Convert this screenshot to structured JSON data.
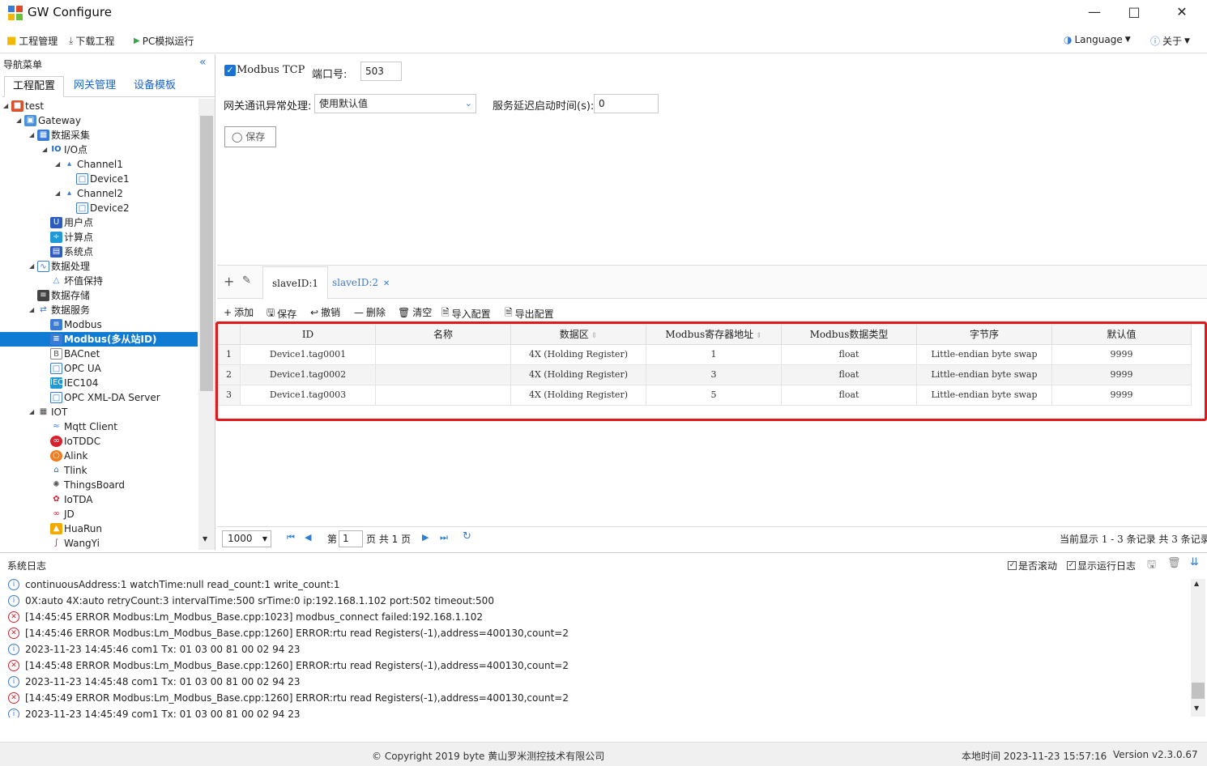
{
  "window": {
    "title": "GW Configure"
  },
  "toolbar": {
    "project_mgmt": "工程管理",
    "download_project": "下载工程",
    "pc_simulate": "PC模拟运行",
    "language": "Language",
    "about": "关于"
  },
  "nav": {
    "title": "导航菜单",
    "tabs": [
      "工程配置",
      "网关管理",
      "设备模板"
    ],
    "tree": {
      "test": "test",
      "gateway": "Gateway",
      "data_collect": "数据采集",
      "io_points": "I/O点",
      "channel1": "Channel1",
      "device1": "Device1",
      "channel2": "Channel2",
      "device2": "Device2",
      "user_points": "用户点",
      "calc_points": "计算点",
      "sys_points": "系统点",
      "data_process": "数据处理",
      "bad_value_hold": "坏值保持",
      "data_storage": "数据存储",
      "data_service": "数据服务",
      "modbus": "Modbus",
      "modbus_multi": "Modbus(多从站ID)",
      "bacnet": "BACnet",
      "opcua": "OPC UA",
      "iec104": "IEC104",
      "opcxml": "OPC XML-DA Server",
      "iot": "IOT",
      "mqtt": "Mqtt Client",
      "iotddc": "IoTDDC",
      "alink": "Alink",
      "tlink": "Tlink",
      "thingsboard": "ThingsBoard",
      "iotda": "IoTDA",
      "jd": "JD",
      "huarun": "HuaRun",
      "wangyi": "WangYi"
    }
  },
  "form": {
    "modbus_tcp_label": "Modbus TCP",
    "modbus_tcp_checked": true,
    "port_label": "端口号:",
    "port_value": "503",
    "comm_error_label": "网关通讯异常处理:",
    "comm_error_value": "使用默认值",
    "delay_label": "服务延迟启动时间(s):",
    "delay_value": "0",
    "save_label": "保存"
  },
  "slave_tabs": [
    "slaveID:1",
    "slaveID:2"
  ],
  "grid_toolbar": {
    "add": "添加",
    "save": "保存",
    "undo": "撤销",
    "delete": "删除",
    "clear": "清空",
    "import": "导入配置",
    "export": "导出配置"
  },
  "table": {
    "columns": [
      "ID",
      "名称",
      "数据区",
      "Modbus寄存器地址",
      "Modbus数据类型",
      "字节序",
      "默认值"
    ],
    "rows": [
      {
        "n": "1",
        "id": "Device1.tag0001",
        "name": "",
        "area": "4X (Holding Register)",
        "addr": "1",
        "type": "float",
        "order": "Little-endian byte swap",
        "default": "9999"
      },
      {
        "n": "2",
        "id": "Device1.tag0002",
        "name": "",
        "area": "4X (Holding Register)",
        "addr": "3",
        "type": "float",
        "order": "Little-endian byte swap",
        "default": "9999"
      },
      {
        "n": "3",
        "id": "Device1.tag0003",
        "name": "",
        "area": "4X (Holding Register)",
        "addr": "5",
        "type": "float",
        "order": "Little-endian byte swap",
        "default": "9999"
      }
    ]
  },
  "pager": {
    "page_size": "1000",
    "page_prefix": "第",
    "page_value": "1",
    "page_suffix": "页 共 1 页",
    "summary": "当前显示 1 - 3 条记录 共 3 条记录"
  },
  "log": {
    "title": "系统日志",
    "auto_scroll": "是否滚动",
    "show_runtime": "显示运行日志",
    "lines": [
      {
        "level": "info",
        "text": "continuousAddress:1 watchTime:null read_count:1 write_count:1"
      },
      {
        "level": "info",
        "text": "0X:auto 4X:auto retryCount:3 intervalTime:500 srTime:0 ip:192.168.1.102 port:502 timeout:500"
      },
      {
        "level": "error",
        "text": "[14:45:45 ERROR Modbus:Lm_Modbus_Base.cpp:1023] modbus_connect failed:192.168.1.102"
      },
      {
        "level": "error",
        "text": "[14:45:46 ERROR Modbus:Lm_Modbus_Base.cpp:1260] ERROR:rtu read Registers(-1),address=400130,count=2"
      },
      {
        "level": "info",
        "text": "2023-11-23 14:45:46 com1 Tx: 01 03 00 81 00 02 94 23"
      },
      {
        "level": "error",
        "text": "[14:45:48 ERROR Modbus:Lm_Modbus_Base.cpp:1260] ERROR:rtu read Registers(-1),address=400130,count=2"
      },
      {
        "level": "info",
        "text": "2023-11-23 14:45:48 com1 Tx: 01 03 00 81 00 02 94 23"
      },
      {
        "level": "error",
        "text": "[14:45:49 ERROR Modbus:Lm_Modbus_Base.cpp:1260] ERROR:rtu read Registers(-1),address=400130,count=2"
      },
      {
        "level": "info",
        "text": "2023-11-23 14:45:49 com1 Tx: 01 03 00 81 00 02 94 23"
      }
    ]
  },
  "status": {
    "copyright": "© Copyright 2019 byte 黄山罗米测控技术有限公司",
    "local_time": "本地时间 2023-11-23 15:57:16",
    "version": "Version v2.3.0.67"
  },
  "colors": {
    "accent": "#0f7bd2",
    "highlight_border": "#e0191c",
    "error": "#d6202b"
  }
}
